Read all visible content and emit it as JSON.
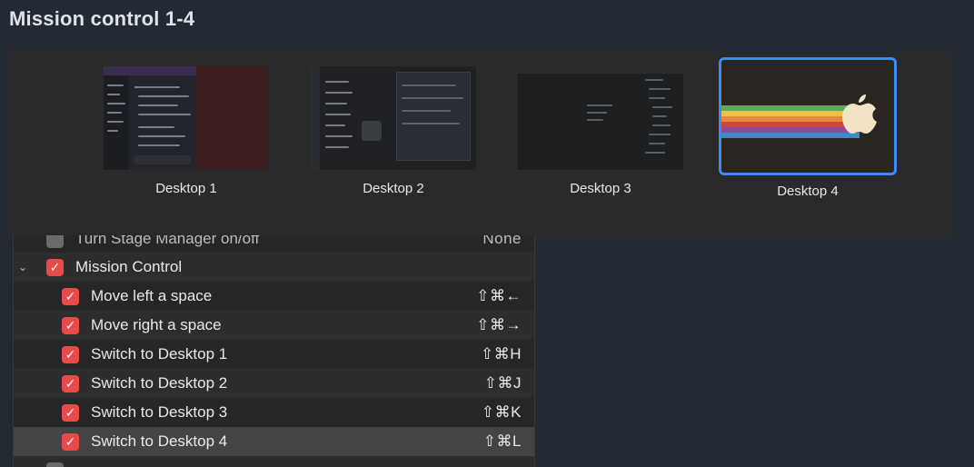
{
  "page": {
    "title": "Mission control 1-4"
  },
  "spaces": [
    {
      "label": "Desktop 1",
      "active": false
    },
    {
      "label": "Desktop 2",
      "active": false
    },
    {
      "label": "Desktop 3",
      "active": false
    },
    {
      "label": "Desktop 4",
      "active": true
    }
  ],
  "colors": {
    "accent": "#3d8bf5",
    "checkbox": "#e64a4a",
    "rainbow": [
      "#5fa85a",
      "#e9c04a",
      "#e38a39",
      "#d1463c",
      "#8c4aa0",
      "#3e8bc9"
    ]
  },
  "list": {
    "partial_top": {
      "label": "Turn Stage Manager on/off",
      "key": "None"
    },
    "group": {
      "label": "Mission Control",
      "icon": "chevron-down-icon",
      "checked": true
    },
    "items": [
      {
        "label": "Move left a space",
        "key": "⇧⌘←",
        "checked": true
      },
      {
        "label": "Move right a space",
        "key": "⇧⌘→",
        "checked": true
      },
      {
        "label": "Switch to Desktop 1",
        "key": "⇧⌘H",
        "checked": true
      },
      {
        "label": "Switch to Desktop 2",
        "key": "⇧⌘J",
        "checked": true
      },
      {
        "label": "Switch to Desktop 3",
        "key": "⇧⌘K",
        "checked": true
      },
      {
        "label": "Switch to Desktop 4",
        "key": "⇧⌘L",
        "checked": true,
        "selected": true
      }
    ]
  }
}
